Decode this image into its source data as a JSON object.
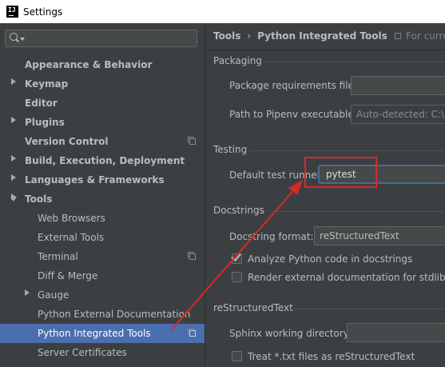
{
  "window": {
    "title": "Settings",
    "app_icon": "intellij-icon"
  },
  "sidebar": {
    "search": {
      "value": "",
      "placeholder": ""
    },
    "items": [
      {
        "label": "Appearance & Behavior",
        "expand": "collapsed",
        "bold": true
      },
      {
        "label": "Keymap",
        "bold": true
      },
      {
        "label": "Editor",
        "expand": "collapsed",
        "bold": true
      },
      {
        "label": "Plugins",
        "bold": true
      },
      {
        "label": "Version Control",
        "expand": "collapsed",
        "bold": true,
        "project_icon": true
      },
      {
        "label": "Build, Execution, Deployment",
        "expand": "collapsed",
        "bold": true
      },
      {
        "label": "Languages & Frameworks",
        "expand": "collapsed",
        "bold": true
      },
      {
        "label": "Tools",
        "expand": "expanded",
        "bold": true
      },
      {
        "label": "Web Browsers"
      },
      {
        "label": "External Tools"
      },
      {
        "label": "Terminal",
        "project_icon": true
      },
      {
        "label": "Diff & Merge",
        "expand": "collapsed"
      },
      {
        "label": "Gauge"
      },
      {
        "label": "Python External Documentation"
      },
      {
        "label": "Python Integrated Tools",
        "selected": true,
        "project_icon": true
      },
      {
        "label": "Server Certificates"
      }
    ]
  },
  "header": {
    "breadcrumb_parent": "Tools",
    "breadcrumb_separator": "›",
    "breadcrumb_current": "Python Integrated Tools",
    "scope_text": "For curren"
  },
  "packaging": {
    "title": "Packaging",
    "requirements_label": "Package requirements file:",
    "requirements_value": "",
    "pipenv_label": "Path to Pipenv executable:",
    "pipenv_value": "Auto-detected: C:\\Us"
  },
  "testing": {
    "title": "Testing",
    "runner_label": "Default test runner:",
    "runner_value": "pytest"
  },
  "docstrings": {
    "title": "Docstrings",
    "format_label": "Docstring format:",
    "format_value": "reStructuredText",
    "analyze_label": "Analyze Python code in docstrings",
    "analyze_checked": true,
    "render_label": "Render external documentation for stdlib",
    "render_checked": false
  },
  "restructured": {
    "title": "reStructuredText",
    "sphinx_label": "Sphinx working directory:",
    "sphinx_value": "",
    "txt_label": "Treat *.txt files as reStructuredText",
    "txt_checked": false
  },
  "colors": {
    "selection": "#4b6eaf",
    "annotation": "#d92828",
    "background": "#3c3f41"
  }
}
